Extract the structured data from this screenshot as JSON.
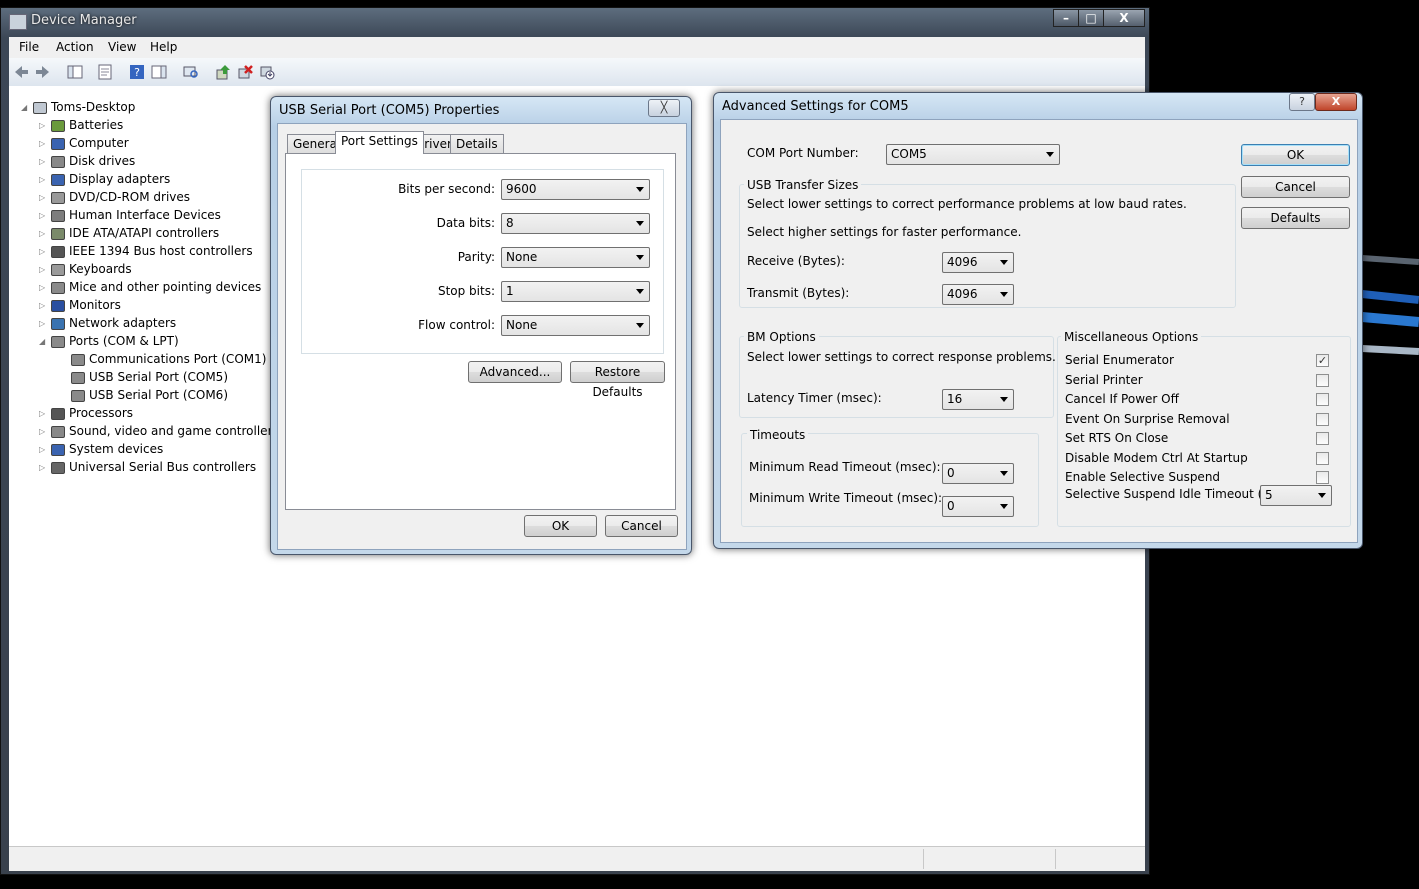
{
  "device_manager": {
    "title": "Device Manager",
    "caption_buttons": {
      "minimize": "–",
      "maximize": "□",
      "close": "X"
    },
    "menu": [
      "File",
      "Action",
      "View",
      "Help"
    ],
    "toolbar_icons": [
      "back-icon",
      "forward-icon",
      "show-hide-console-tree-icon",
      "properties-icon",
      "help-icon",
      "action-pane-icon",
      "scan-hardware-icon",
      "update-driver-icon",
      "uninstall-icon",
      "disable-icon"
    ],
    "tree": {
      "root": "Toms-Desktop",
      "items": [
        {
          "label": "Batteries",
          "icon": "battery-icon",
          "color": "#6a9a3c"
        },
        {
          "label": "Computer",
          "icon": "computer-icon",
          "color": "#3a63b0"
        },
        {
          "label": "Disk drives",
          "icon": "disk-drive-icon",
          "color": "#888888"
        },
        {
          "label": "Display adapters",
          "icon": "display-adapter-icon",
          "color": "#3a63b0"
        },
        {
          "label": "DVD/CD-ROM drives",
          "icon": "dvd-drive-icon",
          "color": "#999999"
        },
        {
          "label": "Human Interface Devices",
          "icon": "hid-icon",
          "color": "#7d7d7d"
        },
        {
          "label": "IDE ATA/ATAPI controllers",
          "icon": "ide-controller-icon",
          "color": "#7a8a6a"
        },
        {
          "label": "IEEE 1394 Bus host controllers",
          "icon": "ieee1394-icon",
          "color": "#555555"
        },
        {
          "label": "Keyboards",
          "icon": "keyboard-icon",
          "color": "#9a9a9a"
        },
        {
          "label": "Mice and other pointing devices",
          "icon": "mouse-icon",
          "color": "#8a8a8a"
        },
        {
          "label": "Monitors",
          "icon": "monitor-icon",
          "color": "#2a4fa0"
        },
        {
          "label": "Network adapters",
          "icon": "network-adapter-icon",
          "color": "#3a73b0"
        },
        {
          "label": "Ports (COM & LPT)",
          "icon": "port-icon",
          "color": "#8a8a8a",
          "expanded": true,
          "children": [
            "Communications Port (COM1)",
            "USB Serial Port (COM5)",
            "USB Serial Port (COM6)"
          ]
        },
        {
          "label": "Processors",
          "icon": "processor-icon",
          "color": "#555555"
        },
        {
          "label": "Sound, video and game controllers",
          "icon": "sound-icon",
          "color": "#888888"
        },
        {
          "label": "System devices",
          "icon": "system-devices-icon",
          "color": "#3a63b0"
        },
        {
          "label": "Universal Serial Bus controllers",
          "icon": "usb-icon",
          "color": "#666666"
        }
      ]
    }
  },
  "properties_dialog": {
    "title": "USB Serial Port (COM5) Properties",
    "close": "╳",
    "tabs": [
      "General",
      "Port Settings",
      "Driver",
      "Details"
    ],
    "active_tab": "Port Settings",
    "fields": [
      {
        "label": "Bits per second:",
        "value": "9600"
      },
      {
        "label": "Data bits:",
        "value": "8"
      },
      {
        "label": "Parity:",
        "value": "None"
      },
      {
        "label": "Stop bits:",
        "value": "1"
      },
      {
        "label": "Flow control:",
        "value": "None"
      }
    ],
    "advanced": "Advanced...",
    "restore": "Restore Defaults",
    "ok": "OK",
    "cancel": "Cancel"
  },
  "advanced_dialog": {
    "title": "Advanced Settings for COM5",
    "help": "?",
    "close": "X",
    "com_port_label": "COM Port Number:",
    "com_port_value": "COM5",
    "ok": "OK",
    "cancel": "Cancel",
    "defaults": "Defaults",
    "usb_group": "USB Transfer Sizes",
    "usb_text1": "Select lower settings to correct performance problems at low baud rates.",
    "usb_text2": "Select higher settings for faster performance.",
    "receive_label": "Receive (Bytes):",
    "receive_value": "4096",
    "transmit_label": "Transmit (Bytes):",
    "transmit_value": "4096",
    "bm_group": "BM Options",
    "bm_text": "Select lower settings to correct response problems.",
    "latency_label": "Latency Timer (msec):",
    "latency_value": "16",
    "timeouts_group": "Timeouts",
    "min_read_label": "Minimum Read Timeout (msec):",
    "min_read_value": "0",
    "min_write_label": "Minimum Write Timeout (msec):",
    "min_write_value": "0",
    "misc_group": "Miscellaneous Options",
    "misc_options": [
      {
        "label": "Serial Enumerator",
        "checked": true
      },
      {
        "label": "Serial Printer",
        "checked": false
      },
      {
        "label": "Cancel If Power Off",
        "checked": false
      },
      {
        "label": "Event On Surprise Removal",
        "checked": false
      },
      {
        "label": "Set RTS On Close",
        "checked": false
      },
      {
        "label": "Disable Modem Ctrl At Startup",
        "checked": false
      },
      {
        "label": "Enable Selective Suspend",
        "checked": false
      }
    ],
    "suspend_label": "Selective Suspend Idle Timeout (secs):",
    "suspend_value": "5"
  }
}
